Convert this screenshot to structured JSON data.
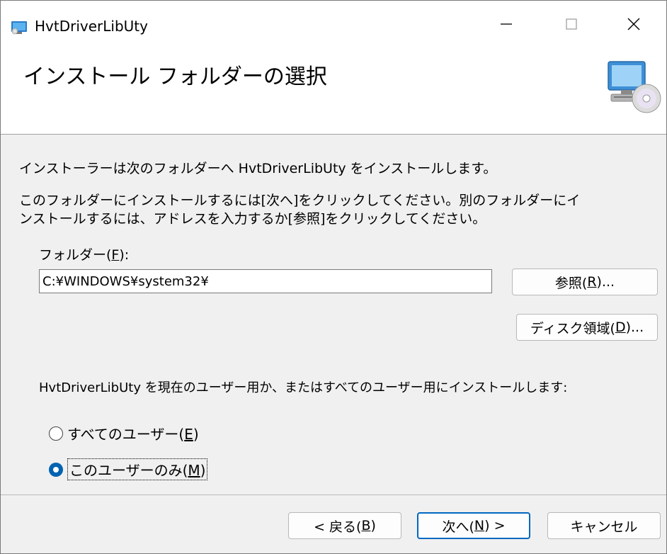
{
  "window": {
    "title": "HvtDriverLibUty",
    "minimize_glyph": "—",
    "maximize_glyph": "☐",
    "close_glyph": "✕"
  },
  "banner": {
    "heading": "インストール フォルダーの選択",
    "icon": "computer-cd-icon"
  },
  "content": {
    "intro": "インストーラーは次のフォルダーへ HvtDriverLibUty をインストールします。",
    "instruction_line1": "このフォルダーにインストールするには[次へ]をクリックしてください。別のフォルダーにイ",
    "instruction_line2": "ンストールするには、アドレスを入力するか[参照]をクリックしてください。",
    "folder_label_prefix": "フォルダー(",
    "folder_label_key": "F",
    "folder_label_suffix": "):",
    "folder_value": "C:¥WINDOWS¥system32¥",
    "browse_prefix": "参照(",
    "browse_key": "R",
    "browse_suffix": ")...",
    "disk_prefix": "ディスク領域(",
    "disk_key": "D",
    "disk_suffix": ")...",
    "scope_text": "HvtDriverLibUty を現在のユーザー用か、またはすべてのユーザー用にインストールします:",
    "radio_all": {
      "prefix": "すべてのユーザー(",
      "key": "E",
      "suffix": ")",
      "checked": false
    },
    "radio_me": {
      "prefix": "このユーザーのみ(",
      "key": "M",
      "suffix": ")",
      "checked": true
    }
  },
  "footer": {
    "back": {
      "prefix": "< 戻る(",
      "key": "B",
      "suffix": ")"
    },
    "next": {
      "prefix": "次へ(",
      "key": "N",
      "suffix": ") >"
    },
    "cancel": "キャンセル"
  },
  "colors": {
    "accent": "#0067c0",
    "radio_checked": "#0063b1"
  }
}
